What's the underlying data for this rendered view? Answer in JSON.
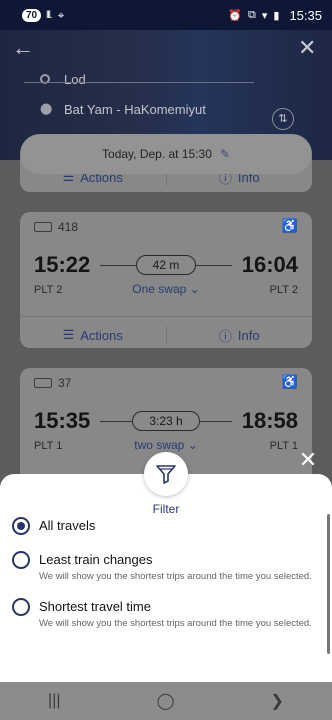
{
  "status_bar": {
    "badge": "70",
    "signal": "lll.",
    "time": "15:35"
  },
  "route": {
    "origin": "Lod",
    "destination": "Bat Yam - HaKomemiyut"
  },
  "date_selector": {
    "label": "Today, Dep. at 15:30"
  },
  "partial_card": {
    "actions_label": "Actions",
    "info_label": "Info"
  },
  "trips": [
    {
      "train_number": "418",
      "departure": "15:22",
      "arrival": "16:04",
      "duration": "42 m",
      "swaps": "One swap",
      "dep_platform": "PLT 2",
      "arr_platform": "PLT 2",
      "actions_label": "Actions",
      "info_label": "Info"
    },
    {
      "train_number": "37",
      "departure": "15:35",
      "arrival": "18:58",
      "duration": "3:23 h",
      "swaps": "two swap",
      "dep_platform": "PLT 1",
      "arr_platform": "PLT 1"
    }
  ],
  "filter_sheet": {
    "title": "Filter",
    "options": [
      {
        "label": "All travels",
        "subtitle": "",
        "checked": true
      },
      {
        "label": "Least train changes",
        "subtitle": "We will show you the shortest trips around the time you selected.",
        "checked": false
      },
      {
        "label": "Shortest travel time",
        "subtitle": "We will show you the shortest trips around the time you selected.",
        "checked": false
      }
    ]
  },
  "colors": {
    "accent": "#27356a",
    "header_bg": "#1f2640",
    "status_bar_bg": "#0e1836"
  }
}
